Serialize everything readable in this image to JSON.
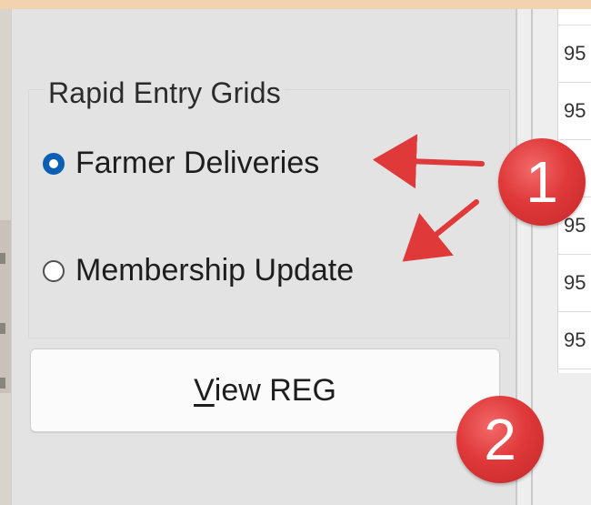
{
  "panel": {
    "group_title": "Rapid Entry Grids",
    "options": [
      {
        "label": "Farmer Deliveries",
        "selected": true
      },
      {
        "label": "Membership Update",
        "selected": false
      }
    ],
    "button_label_first": "V",
    "button_label_rest": "iew REG"
  },
  "grid": {
    "rows": [
      "95",
      "95",
      "",
      "95",
      "95",
      "95"
    ]
  },
  "annotations": {
    "badge_1": "1",
    "badge_2": "2",
    "accent_color": "#e0393a"
  },
  "colors": {
    "frame": "#f3d2b0",
    "panel": "#e3e3e3",
    "radio_selected": "#0a5fb4"
  }
}
